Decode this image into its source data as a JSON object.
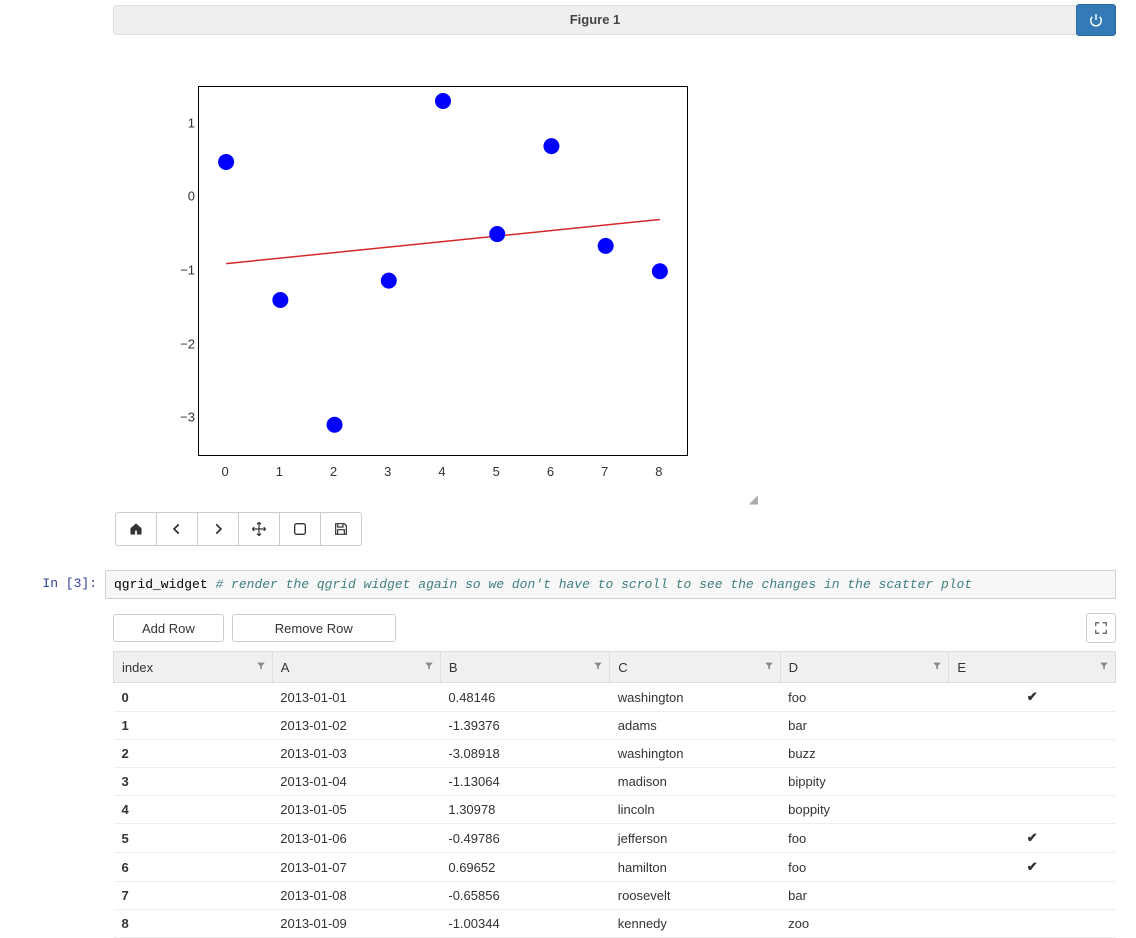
{
  "figure": {
    "title": "Figure 1"
  },
  "chart_data": {
    "type": "scatter",
    "x": [
      0,
      1,
      2,
      3,
      4,
      5,
      6,
      7,
      8
    ],
    "y": [
      0.48146,
      -1.39376,
      -3.08918,
      -1.13064,
      1.30978,
      -0.49786,
      0.69652,
      -0.65856,
      -1.00344
    ],
    "y_ticks": [
      -3,
      -2,
      -1,
      0,
      1
    ],
    "x_ticks": [
      0,
      1,
      2,
      3,
      4,
      5,
      6,
      7,
      8
    ],
    "trend": {
      "x": [
        0,
        8
      ],
      "y": [
        -0.9,
        -0.3
      ]
    },
    "point_color": "#0000ff",
    "trend_color": "#d62728",
    "ylim": [
      -3.5,
      1.5
    ],
    "xlim": [
      -0.5,
      8.5
    ]
  },
  "code": {
    "prompt": "In [3]:",
    "var": "qgrid_widget",
    "comment": "# render the qgrid widget again so we don't have to scroll to see the changes in the scatter plot"
  },
  "grid_buttons": {
    "add": "Add Row",
    "remove": "Remove Row"
  },
  "grid": {
    "headers": [
      "index",
      "A",
      "B",
      "C",
      "D",
      "E"
    ],
    "rows": [
      {
        "index": "0",
        "A": "2013-01-01",
        "B": "0.48146",
        "C": "washington",
        "D": "foo",
        "E": true
      },
      {
        "index": "1",
        "A": "2013-01-02",
        "B": "-1.39376",
        "C": "adams",
        "D": "bar",
        "E": false
      },
      {
        "index": "2",
        "A": "2013-01-03",
        "B": "-3.08918",
        "C": "washington",
        "D": "buzz",
        "E": false
      },
      {
        "index": "3",
        "A": "2013-01-04",
        "B": "-1.13064",
        "C": "madison",
        "D": "bippity",
        "E": false
      },
      {
        "index": "4",
        "A": "2013-01-05",
        "B": "1.30978",
        "C": "lincoln",
        "D": "boppity",
        "E": false
      },
      {
        "index": "5",
        "A": "2013-01-06",
        "B": "-0.49786",
        "C": "jefferson",
        "D": "foo",
        "E": true
      },
      {
        "index": "6",
        "A": "2013-01-07",
        "B": "0.69652",
        "C": "hamilton",
        "D": "foo",
        "E": true
      },
      {
        "index": "7",
        "A": "2013-01-08",
        "B": "-0.65856",
        "C": "roosevelt",
        "D": "bar",
        "E": false
      },
      {
        "index": "8",
        "A": "2013-01-09",
        "B": "-1.00344",
        "C": "kennedy",
        "D": "zoo",
        "E": false
      }
    ]
  }
}
